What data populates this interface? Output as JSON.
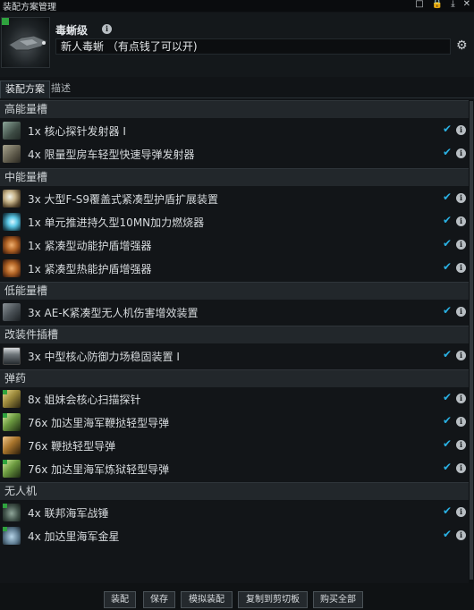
{
  "window": {
    "title": "装配方案管理",
    "controls": [
      "□",
      "🔒",
      "⤓",
      "✕"
    ]
  },
  "header": {
    "ship_name": "毒蜥级",
    "fitting_name": "新人毒蜥 （有点钱了可以开)"
  },
  "tabs": [
    {
      "label": "装配方案",
      "active": true
    },
    {
      "label": "描述",
      "active": false
    }
  ],
  "sections": [
    {
      "title": "高能量槽",
      "items": [
        {
          "text": "1x 核心探针发射器 I",
          "icon": "probe-launcher-icon"
        },
        {
          "text": "4x 限量型房车轻型快速导弹发射器",
          "icon": "missile-launcher-icon"
        }
      ]
    },
    {
      "title": "中能量槽",
      "items": [
        {
          "text": "3x 大型F-S9覆盖式紧凑型护盾扩展装置",
          "icon": "shield-extender-icon"
        },
        {
          "text": "1x 单元推进持久型10MN加力燃烧器",
          "icon": "afterburner-icon"
        },
        {
          "text": "1x 紧凑型动能护盾增强器",
          "icon": "shield-hardener-icon"
        },
        {
          "text": "1x 紧凑型热能护盾增强器",
          "icon": "shield-hardener-icon"
        }
      ]
    },
    {
      "title": "低能量槽",
      "items": [
        {
          "text": "3x AE-K紧凑型无人机伤害增效装置",
          "icon": "drone-damage-amplifier-icon"
        }
      ]
    },
    {
      "title": "改装件插槽",
      "items": [
        {
          "text": "3x 中型核心防御力场稳固装置 I",
          "icon": "rig-icon"
        }
      ]
    },
    {
      "title": "弹药",
      "items": [
        {
          "text": "8x 姐妹会核心扫描探针",
          "icon": "scan-probe-icon"
        },
        {
          "text": "76x 加达里海军鞭挞轻型导弹",
          "icon": "light-missile-icon"
        },
        {
          "text": "76x 鞭挞轻型导弹",
          "icon": "light-missile-icon"
        },
        {
          "text": "76x 加达里海军炼狱轻型导弹",
          "icon": "light-missile-icon"
        }
      ]
    },
    {
      "title": "无人机",
      "items": [
        {
          "text": "4x 联邦海军战锤",
          "icon": "drone-icon"
        },
        {
          "text": "4x 加达里海军金星",
          "icon": "drone-icon"
        }
      ]
    }
  ],
  "row_status": {
    "check": "✔",
    "info": "i"
  },
  "footer": {
    "buttons": [
      "装配",
      "保存",
      "模拟装配",
      "复制到剪切板",
      "购买全部"
    ]
  },
  "colors": {
    "accent_check": "#2ab0e2",
    "section_bg": "#22272b",
    "panel_bg": "#121518"
  }
}
